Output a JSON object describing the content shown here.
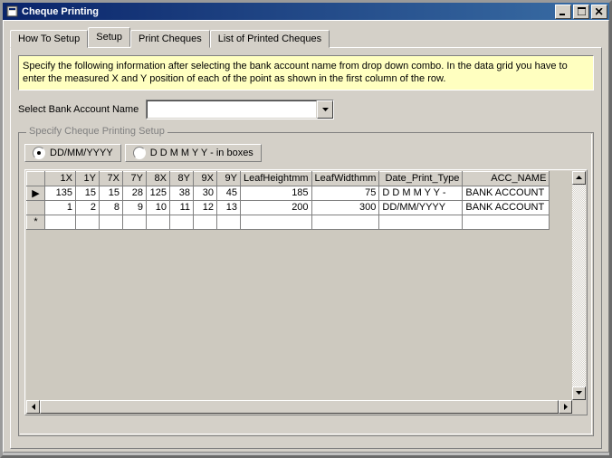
{
  "window": {
    "title": "Cheque Printing"
  },
  "tabs": [
    {
      "label": "How To Setup"
    },
    {
      "label": "Setup"
    },
    {
      "label": "Print Cheques"
    },
    {
      "label": "List of Printed Cheques"
    }
  ],
  "info_text": "Specify the following information after selecting the bank account name from drop down combo. In the data grid you have to enter the measured X and Y position of each of the point as shown in the first column of the row.",
  "bank": {
    "label": "Select Bank Account Name",
    "value": ""
  },
  "groupbox_title": "Specify Cheque Printing Setup",
  "date_format": {
    "opt1": "DD/MM/YYYY",
    "opt2": "D D M M Y Y - in boxes"
  },
  "columns": [
    "1X",
    "1Y",
    "7X",
    "7Y",
    "8X",
    "8Y",
    "9X",
    "9Y",
    "LeafHeightmm",
    "LeafWidthmm",
    "Date_Print_Type",
    "ACC_NAME"
  ],
  "rows": [
    {
      "marker": "▶",
      "c": [
        "135",
        "15",
        "15",
        "28",
        "125",
        "38",
        "30",
        "45",
        "185",
        "75",
        "D D M M Y Y -",
        "BANK ACCOUNT"
      ]
    },
    {
      "marker": "",
      "c": [
        "1",
        "2",
        "8",
        "9",
        "10",
        "11",
        "12",
        "13",
        "200",
        "300",
        "DD/MM/YYYY",
        "BANK ACCOUNT"
      ]
    }
  ],
  "newrow_marker": "*"
}
